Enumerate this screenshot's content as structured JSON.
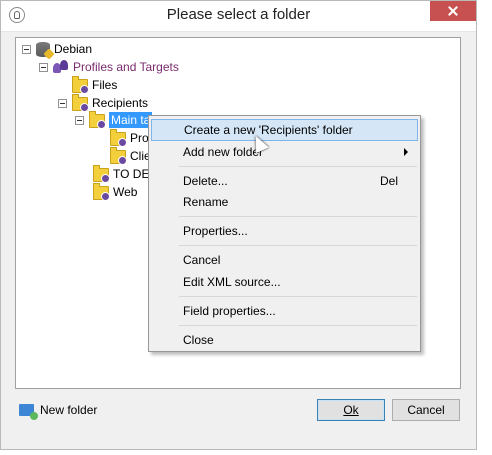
{
  "window": {
    "title": "Please select a folder"
  },
  "tree": {
    "root": "Debian",
    "profiles": "Profiles and Targets",
    "files": "Files",
    "recipients": "Recipients",
    "main": "Main ta",
    "pro": "Pro",
    "cli": "Clie",
    "todel": "TO DEL",
    "web": "Web"
  },
  "menu": {
    "create": "Create a new 'Recipients' folder",
    "add": "Add new folder",
    "delete": "Delete...",
    "delete_shortcut": "Del",
    "rename": "Rename",
    "properties": "Properties...",
    "cancel": "Cancel",
    "edit_xml": "Edit XML source...",
    "field_props": "Field properties...",
    "close": "Close"
  },
  "footer": {
    "new_folder": "New folder",
    "ok": "Ok",
    "cancel": "Cancel"
  },
  "colors": {
    "selection": "#3399ff",
    "close_button": "#c75050",
    "folder": "#f4cf3c",
    "menu_hover": "#d5e6f7"
  },
  "icons": [
    "app-icon",
    "close-icon",
    "database-icon",
    "people-icon",
    "folder-icon",
    "new-folder-icon",
    "submenu-arrow-icon",
    "mouse-cursor-icon"
  ]
}
